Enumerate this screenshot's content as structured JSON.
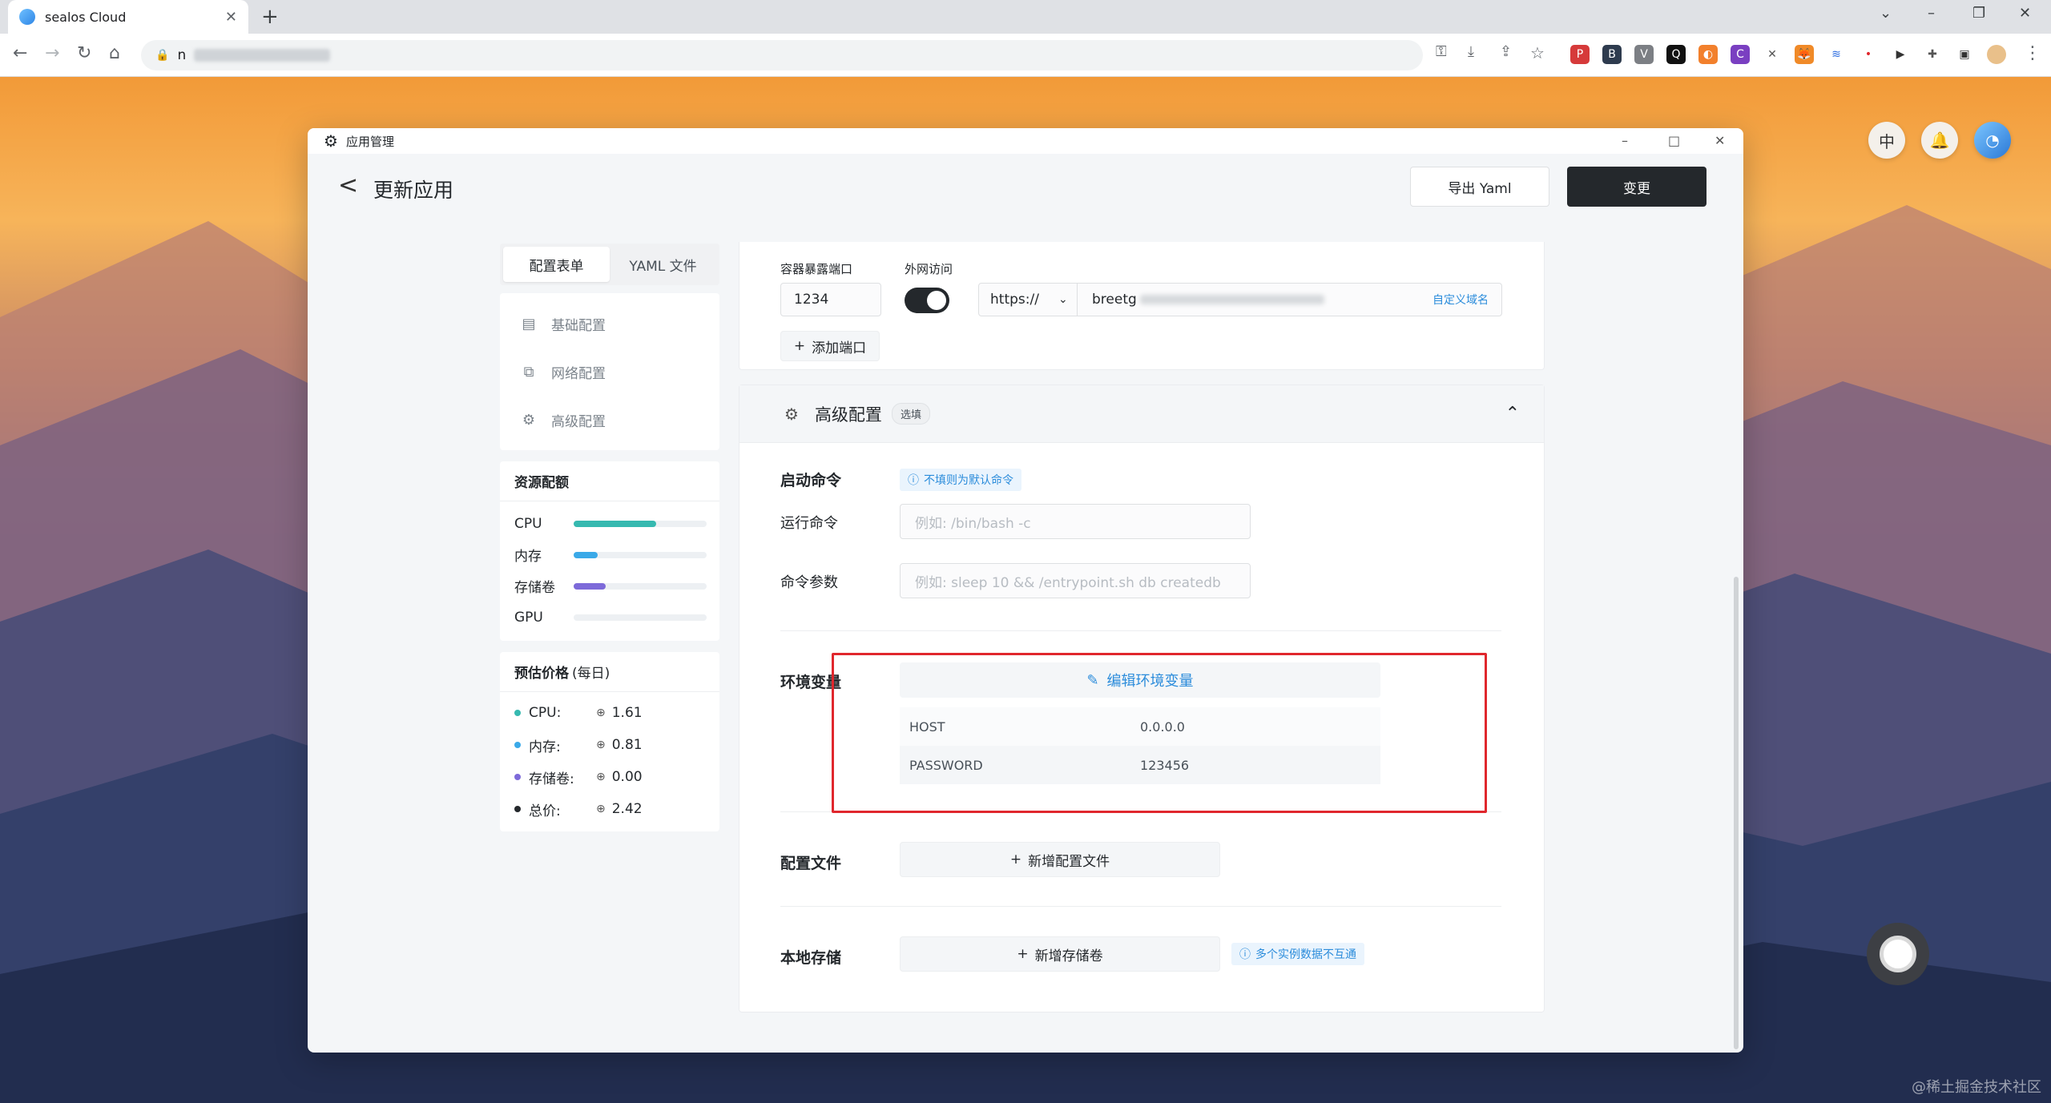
{
  "browser": {
    "tab_title": "sealos Cloud",
    "tab_close": "✕",
    "new_tab": "+",
    "url_visible": "n"
  },
  "desktop": {
    "icon_lang": "中",
    "watermark": "@稀土掘金技术社区"
  },
  "window": {
    "title": "应用管理"
  },
  "header": {
    "back": "<",
    "title": "更新应用",
    "export_label": "导出 Yaml",
    "change_label": "变更"
  },
  "sidebar": {
    "tabs": [
      {
        "label": "配置表单",
        "active": true
      },
      {
        "label": "YAML 文件",
        "active": false
      }
    ],
    "nav": [
      {
        "label": "基础配置",
        "icon": "document-icon"
      },
      {
        "label": "网络配置",
        "icon": "network-icon"
      },
      {
        "label": "高级配置",
        "icon": "gear-icon"
      }
    ],
    "quota_title": "资源配额",
    "quota": [
      {
        "label": "CPU",
        "fraction": 0.62,
        "color": "#36b9b0"
      },
      {
        "label": "内存",
        "fraction": 0.18,
        "color": "#3aa9e8"
      },
      {
        "label": "存储卷",
        "fraction": 0.24,
        "color": "#7d6ad9"
      },
      {
        "label": "GPU",
        "fraction": 0.0,
        "color": "#9aa3ad"
      }
    ],
    "price_title": "预估价格",
    "price_sub": "(每日)",
    "prices": [
      {
        "label": "CPU:",
        "value": "1.61",
        "color": "#36b9b0"
      },
      {
        "label": "内存:",
        "value": "0.81",
        "color": "#3aa9e8"
      },
      {
        "label": "存储卷:",
        "value": "0.00",
        "color": "#7d6ad9"
      },
      {
        "label": "总价:",
        "value": "2.42",
        "color": "#24282c"
      }
    ]
  },
  "network": {
    "port_label": "容器暴露端口",
    "public_label": "外网访问",
    "port_value": "1234",
    "protocol": "https://",
    "domain_prefix": "breetg",
    "custom_domain": "自定义域名",
    "add_port": "添加端口"
  },
  "advanced": {
    "title": "高级配置",
    "optional_badge": "选填",
    "start_cmd_label": "启动命令",
    "start_cmd_tip": "不填则为默认命令",
    "run_cmd_label": "运行命令",
    "run_cmd_placeholder": "例如: /bin/bash -c",
    "cmd_args_label": "命令参数",
    "cmd_args_placeholder": "例如: sleep 10 && /entrypoint.sh db createdb",
    "env_label": "环境变量",
    "env_edit": "编辑环境变量",
    "env_vars": [
      {
        "key": "HOST",
        "value": "0.0.0.0"
      },
      {
        "key": "PASSWORD",
        "value": "123456"
      }
    ],
    "config_file_label": "配置文件",
    "add_config_file": "新增配置文件",
    "local_storage_label": "本地存储",
    "add_storage": "新增存储卷",
    "storage_tip": "多个实例数据不互通"
  }
}
